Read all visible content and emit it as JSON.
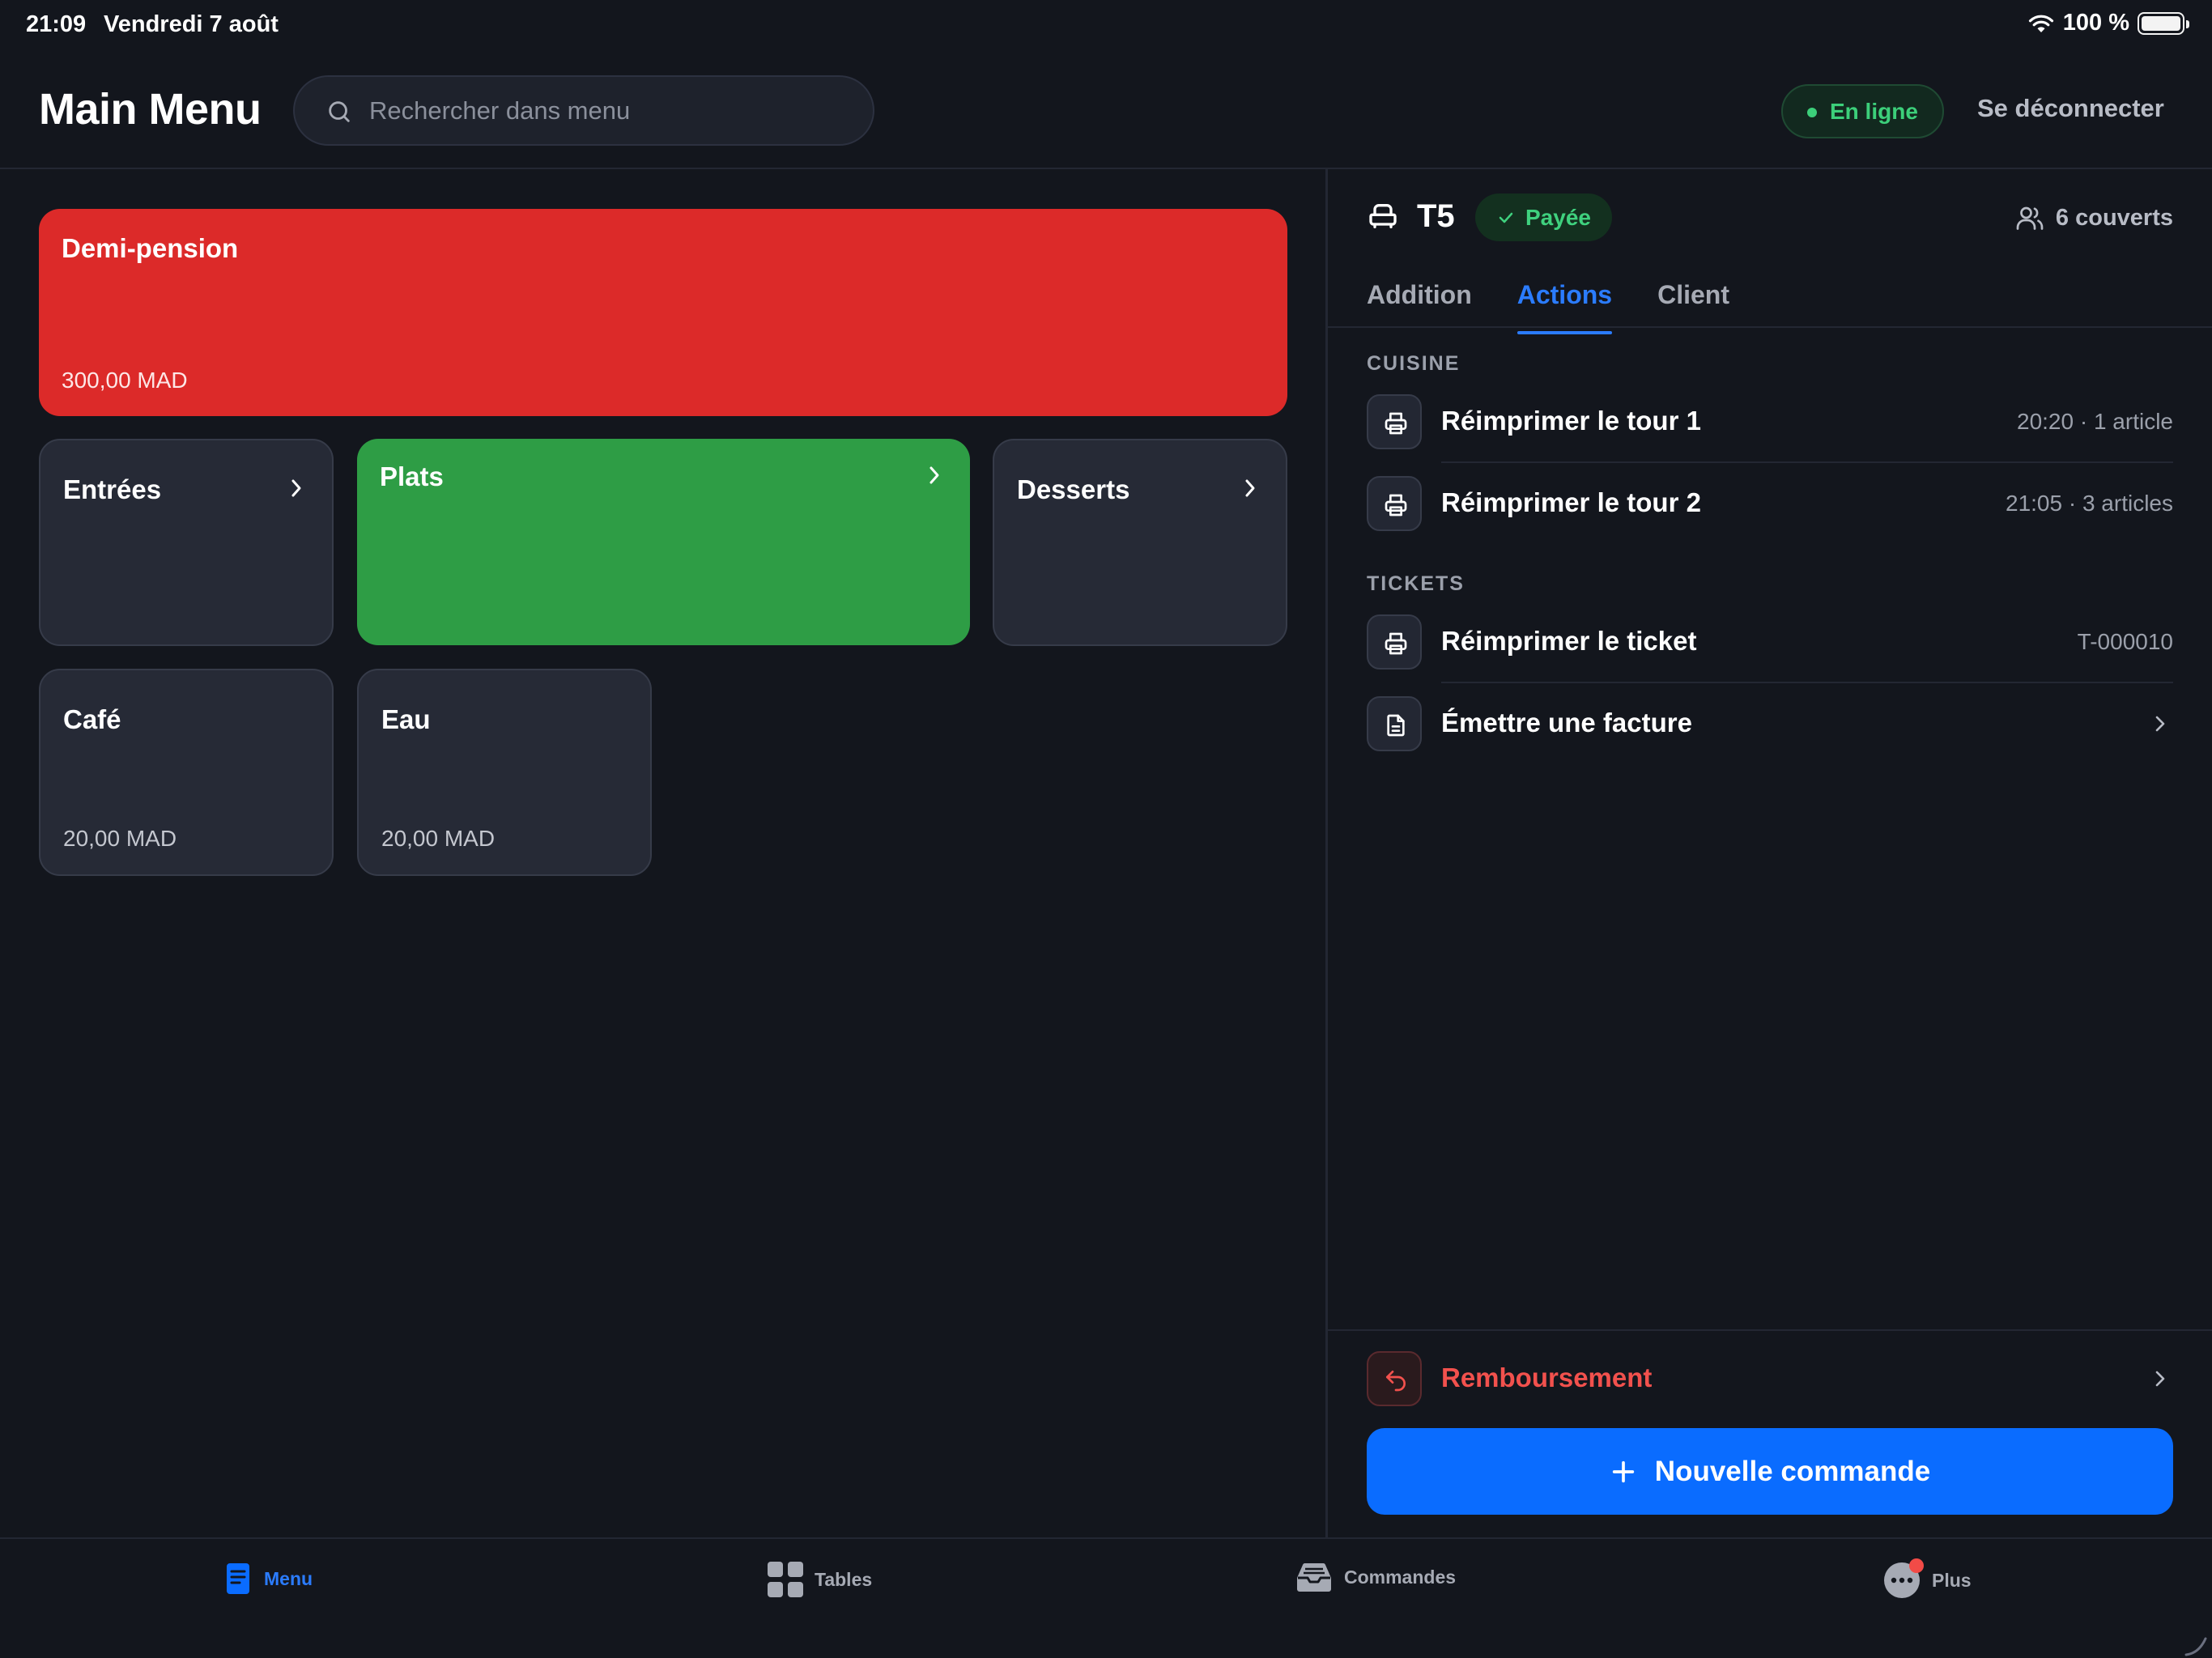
{
  "status_bar": {
    "time": "21:09",
    "date": "Vendredi 7 août",
    "battery": "100 %"
  },
  "header": {
    "title": "Main Menu",
    "search_placeholder": "Rechercher dans menu",
    "online_status": "En ligne",
    "logout": "Se déconnecter"
  },
  "menu": {
    "tiles": [
      {
        "name": "Demi-pension",
        "price": "300,00 MAD",
        "color": "#dc2a29"
      },
      {
        "name": "Entrées",
        "price": "",
        "has_children": true
      },
      {
        "name": "Plats",
        "price": "",
        "has_children": true,
        "color": "#2e9d45"
      },
      {
        "name": "Desserts",
        "price": "",
        "has_children": true
      },
      {
        "name": "Café",
        "price": "20,00 MAD"
      },
      {
        "name": "Eau",
        "price": "20,00 MAD"
      }
    ]
  },
  "panel": {
    "table": "T5",
    "status": "Payée",
    "covers": "6 couverts",
    "tabs": [
      "Addition",
      "Actions",
      "Client"
    ],
    "active_tab": "Actions",
    "sections": {
      "kitchen": {
        "title": "CUISINE",
        "items": [
          {
            "label": "Réimprimer le tour 1",
            "meta": "20:20 · 1 article",
            "icon": "printer-icon"
          },
          {
            "label": "Réimprimer le tour 2",
            "meta": "21:05 · 3 articles",
            "icon": "printer-icon"
          }
        ]
      },
      "tickets": {
        "title": "TICKETS",
        "items": [
          {
            "label": "Réimprimer le ticket",
            "meta": "T-000010",
            "icon": "printer-icon"
          },
          {
            "label": "Émettre une facture",
            "meta": "",
            "icon": "document-icon"
          }
        ]
      }
    },
    "refund": "Remboursement",
    "new_order": "Nouvelle commande"
  },
  "bottom_nav": {
    "items": [
      {
        "label": "Menu",
        "icon": "menu-book-icon",
        "active": true
      },
      {
        "label": "Tables",
        "icon": "grid-icon"
      },
      {
        "label": "Commandes",
        "icon": "inbox-icon"
      },
      {
        "label": "Plus",
        "icon": "more-icon",
        "has_notification": true
      }
    ]
  },
  "colors": {
    "background": "#13161d",
    "accent": "#0a6cff",
    "success": "#3ccf7a",
    "danger": "#f2514d"
  }
}
